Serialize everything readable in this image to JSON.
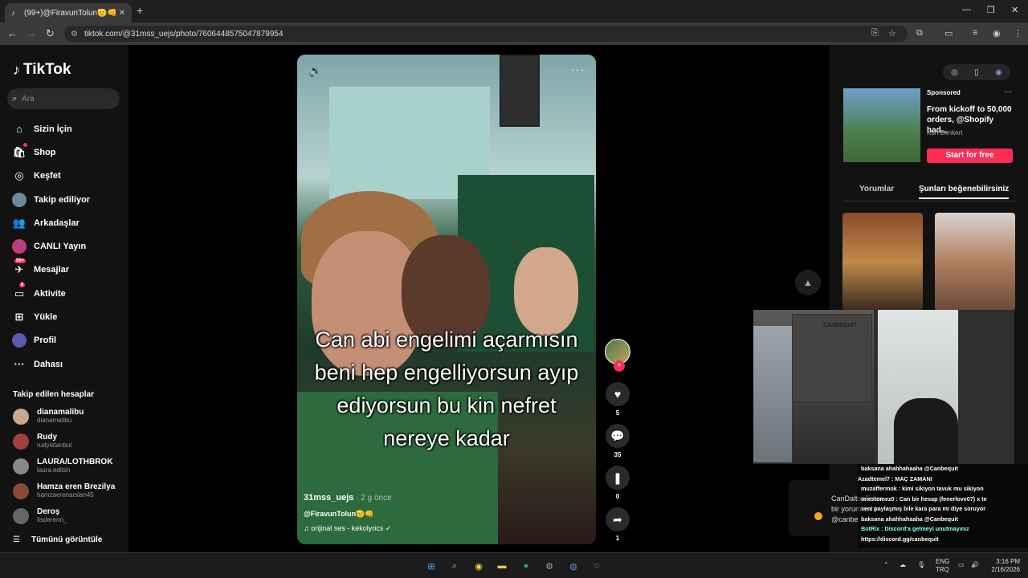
{
  "browser": {
    "tab_title": "(99+)@FiravunTolun🫡👊 | Tik",
    "new_tab": "+",
    "url": "tiktok.com/@31mss_uejs/photo/7606448575047879954"
  },
  "sidebar": {
    "logo": "TikTok",
    "search_placeholder": "Ara",
    "nav": [
      {
        "label": "Sizin İçin",
        "icon": "home-icon"
      },
      {
        "label": "Shop",
        "icon": "shop-icon"
      },
      {
        "label": "Keşfet",
        "icon": "compass-icon"
      },
      {
        "label": "Takip ediliyor",
        "icon": "avatar"
      },
      {
        "label": "Arkadaşlar",
        "icon": "friends-icon"
      },
      {
        "label": "CANLI Yayın",
        "icon": "live-icon"
      },
      {
        "label": "Mesajlar",
        "icon": "messages-icon",
        "badge": "99+"
      },
      {
        "label": "Aktivite",
        "icon": "activity-icon",
        "badge": "6"
      },
      {
        "label": "Yükle",
        "icon": "upload-icon"
      },
      {
        "label": "Profil",
        "icon": "profile-icon"
      },
      {
        "label": "Dahası",
        "icon": "more-icon"
      }
    ],
    "following_title": "Takip edilen hesaplar",
    "accounts": [
      {
        "name": "dianamalibu",
        "handle": "dianamalibu"
      },
      {
        "name": "Rudy",
        "handle": "rudyistanbul"
      },
      {
        "name": "LAURA/LOTHBROK",
        "handle": "laura.editsh"
      },
      {
        "name": "Hamza eren Brezilya",
        "handle": "hamzaerenarslan45"
      },
      {
        "name": "Deroş",
        "handle": "itsderenn_"
      }
    ],
    "see_all": "Tümünü görüntüle"
  },
  "post": {
    "caption_lines": [
      "Can abi engelimi açarmısın",
      "beni hep engelliyorsun ayıp",
      "ediyorsun bu kin nefret",
      "nereye kadar"
    ],
    "author": "31mss_uejs",
    "ago": "· 2 g önce",
    "description": "@FiravunTolun🫡👊",
    "music": "♫  orijinal ses - kekolyrics ✓",
    "likes": "5",
    "comments": "35",
    "saves": "0",
    "shares": "1"
  },
  "right": {
    "ad": {
      "sponsored": "Sponsored",
      "title": "From kickoff to 50,000 orders, @Shopify had...",
      "author": "Kurt Benkert",
      "cta": "Start for free"
    },
    "tabs": [
      "Yorumlar",
      "Şunları beğenebilirsiniz"
    ]
  },
  "overlay": {
    "poster_text": "CANBEQUIT",
    "chat": [
      "baksana ahahhahaaha @Canbequit",
      "Azadtemel7 : MAÇ ZAMANI",
      "muzaffermok : kimi sikiyon tavuk mu sikiyon",
      "onestomez0 : Can bir hesap (fenerlove07) x te",
      "seni paylaşmış bile kara para mı diye soruyor",
      "baksana ahahhahaaha @Canbequit",
      "BotRix : Discord'a gelmeyi unutmayınız",
      "https://discord.gg/canbequit"
    ],
    "alert_lines": [
      "CanDaltonTolun",
      "bir yorum seni",
      "@canbe"
    ]
  },
  "taskbar": {
    "lang1": "ENG",
    "lang2": "TRQ",
    "time": "3:16 PM",
    "date": "2/16/2026"
  },
  "colors": {
    "accent": "#fe2c55",
    "bg": "#121212"
  }
}
